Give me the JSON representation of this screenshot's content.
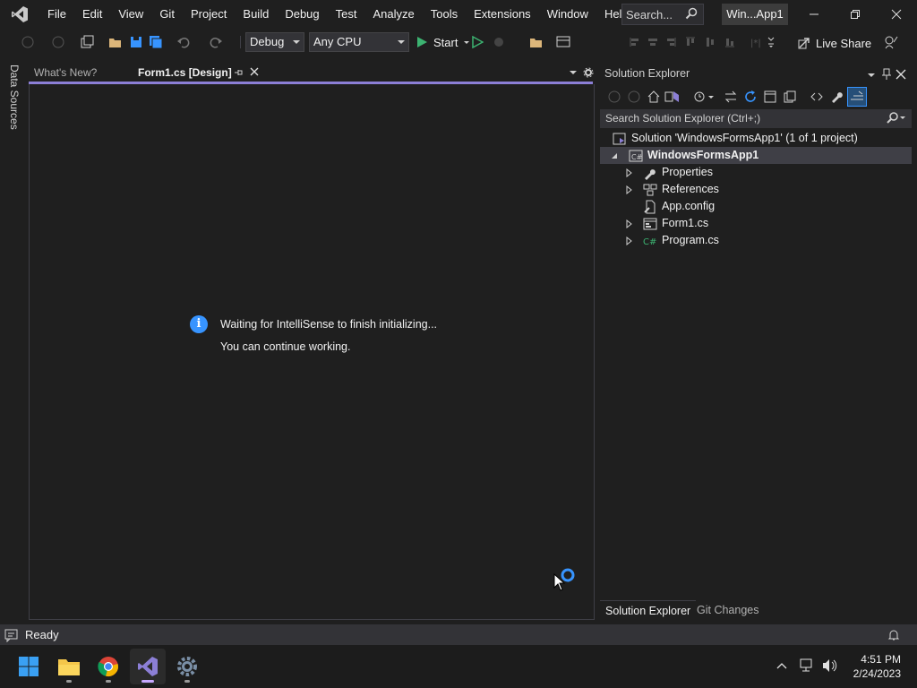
{
  "menu": [
    "File",
    "Edit",
    "View",
    "Git",
    "Project",
    "Build",
    "Debug",
    "Test",
    "Analyze",
    "Tools",
    "Extensions",
    "Window",
    "Help"
  ],
  "search": {
    "placeholder": "Search..."
  },
  "project_title": "Win...App1",
  "toolbar": {
    "config": "Debug",
    "platform": "Any CPU",
    "start_label": "Start",
    "live_share": "Live Share"
  },
  "side": {
    "data_sources": "Data Sources"
  },
  "doc_tabs": [
    {
      "label": "What's New?",
      "active": false
    },
    {
      "label": "Form1.cs [Design]",
      "active": true
    }
  ],
  "designer": {
    "message_line1": "Waiting for IntelliSense to finish initializing...",
    "message_line2": "You can continue working."
  },
  "solution_explorer": {
    "title": "Solution Explorer",
    "search_placeholder": "Search Solution Explorer (Ctrl+;)",
    "tree": [
      {
        "label": "Solution 'WindowsFormsApp1' (1 of 1 project)",
        "icon": "solution-icon",
        "level": 0,
        "expander": "none",
        "bold": false
      },
      {
        "label": "WindowsFormsApp1",
        "icon": "csharp-project-icon",
        "level": 1,
        "expander": "expanded",
        "bold": true
      },
      {
        "label": "Properties",
        "icon": "wrench-icon",
        "level": 2,
        "expander": "collapsed",
        "bold": false
      },
      {
        "label": "References",
        "icon": "references-icon",
        "level": 2,
        "expander": "collapsed",
        "bold": false
      },
      {
        "label": "App.config",
        "icon": "config-file-icon",
        "level": 2,
        "expander": "none",
        "bold": false
      },
      {
        "label": "Form1.cs",
        "icon": "form-icon",
        "level": 2,
        "expander": "collapsed",
        "bold": false
      },
      {
        "label": "Program.cs",
        "icon": "csharp-file-icon",
        "level": 2,
        "expander": "collapsed",
        "bold": false
      }
    ],
    "bottom_tabs": [
      "Solution Explorer",
      "Git Changes"
    ]
  },
  "status": {
    "text": "Ready"
  },
  "taskbar": {
    "apps": [
      "windows-start-icon",
      "file-explorer-icon",
      "chrome-icon",
      "visual-studio-icon",
      "settings-icon"
    ],
    "time": "4:51 PM",
    "date": "2/24/2023"
  },
  "colors": {
    "accent": "#8c7fd6",
    "info": "#3794ff",
    "background": "#1f1f1f"
  }
}
